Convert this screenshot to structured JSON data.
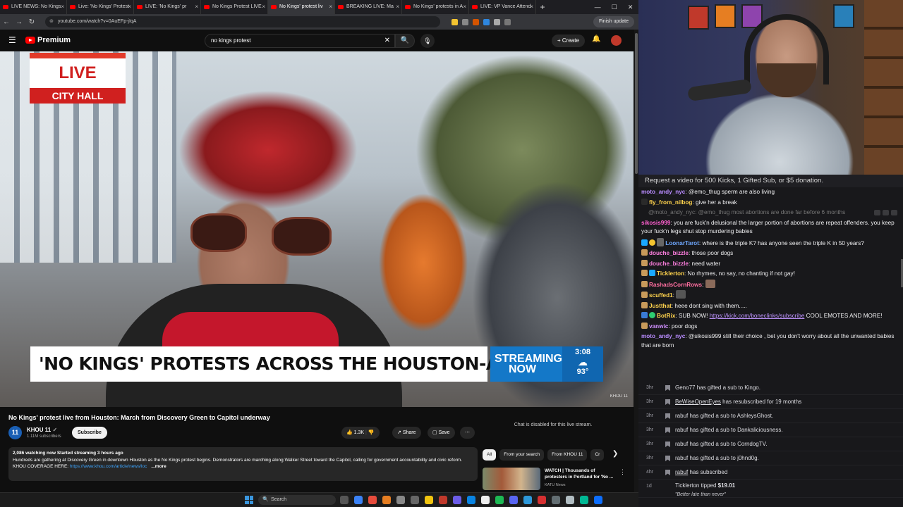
{
  "browser": {
    "tabs": [
      {
        "title": "LIVE NEWS: No Kings",
        "active": false
      },
      {
        "title": "Live: 'No Kings' Protest",
        "active": false
      },
      {
        "title": "LIVE: 'No Kings' pr",
        "active": false
      },
      {
        "title": "No Kings Protest LIVE",
        "active": false
      },
      {
        "title": "No Kings' protest liv",
        "active": true
      },
      {
        "title": "BREAKING LIVE: Ma",
        "active": false
      },
      {
        "title": "No Kings' protests in A",
        "active": false
      },
      {
        "title": "LIVE: VP Vance Attend",
        "active": false
      }
    ],
    "new_tab": "+",
    "window_controls": [
      "—",
      "☐",
      "✕"
    ],
    "url": "youtube.com/watch?v=0AuEFp-jIqA",
    "finish_update": "Finish update"
  },
  "youtube": {
    "logo": "Premium",
    "search_value": "no kings protest",
    "clear": "✕",
    "search_icon": "🔍",
    "mic_icon": "🎙",
    "create": "+ Create",
    "bell": "🔔",
    "video": {
      "live_label": "LIVE",
      "location": "CITY HALL",
      "headline": "'NO KINGS' PROTESTS ACROSS THE HOUSTON-AREA",
      "streaming_line1": "STREAMING",
      "streaming_line2": "NOW",
      "time": "3:08",
      "weather_icon": "☁",
      "temperature": "93°",
      "bug": "KHOU 11"
    },
    "title": "No Kings' protest live from Houston: March from Discovery Green to Capitol underway",
    "channel": {
      "logo_text": "11",
      "name": "KHOU 11",
      "subscribers": "1.11M subscribers",
      "subscribe": "Subscribe"
    },
    "actions": {
      "likes": "1.3K",
      "like_icon": "👍",
      "dislike_icon": "👎",
      "share": "Share",
      "save": "Save",
      "more": "⋯"
    },
    "description": {
      "meta": "2,086 watching now  Started streaming 3 hours ago",
      "text": "Hundreds are gathering at Discovery Green in downtown Houston as the No Kings protest begins. Demonstrators are marching along Walker Street toward the Capitol, calling for government accountability and civic reform.",
      "link_prefix": "KHOU COVERAGE HERE: ",
      "link": "https://www.khou.com/article/news/loc",
      "more": "...more"
    },
    "chat_disabled": "Chat is disabled for this live stream.",
    "chips": [
      "All",
      "From your search",
      "From KHOU 11",
      "Cr"
    ],
    "chips_arrow": "❯",
    "recommendation": {
      "title": "WATCH | Thousands of protesters in Portland for 'No ...",
      "channel": "KATU News",
      "menu": "⋮"
    }
  },
  "taskbar": {
    "search": "Search",
    "search_icon": "🔍"
  },
  "chat": {
    "banner": "Request a video for 500 Kicks, 1 Gifted Sub, or $5 donation.",
    "messages": [
      {
        "user": "moto_andy_nyc",
        "color": "#b98cff",
        "text": "@emo_thug sperm are also living"
      },
      {
        "user": "fly_from_nilbog",
        "color": "#ffd34d",
        "text": "give her a break"
      },
      {
        "user": "",
        "color": "#777",
        "text": "@moto_andy_nyc: @emo_thug most abortions are done far before 6 months",
        "faded": true
      },
      {
        "user": "sikosis999",
        "color": "#ff5fd0",
        "text": "you are fuck'n delusional the larger portion of abortions are repeat offenders. you keep your fuck'n legs shut stop murdering babies",
        "wrap": true
      },
      {
        "user": "LoonarTarot",
        "color": "#6fa8ff",
        "text": "where is the triple K? has anyone seen the triple K in 50 years?"
      },
      {
        "user": "douche_bizzle",
        "color": "#ff7fe0",
        "text": "those poor dogs"
      },
      {
        "user": "douche_bizzle",
        "color": "#ff7fe0",
        "text": "need water"
      },
      {
        "user": "Ticklerton",
        "color": "#ffd34d",
        "text": "No rhymes, no say, no chanting if not gay!"
      },
      {
        "user": "RashadsCornRows",
        "color": "#ff6fa0",
        "text": ""
      },
      {
        "user": "scuffed1",
        "color": "#ffd34d",
        "text": ""
      },
      {
        "user": "Justthat",
        "color": "#ffd34d",
        "text": "heee dont sing with them....."
      },
      {
        "user": "BotRix",
        "color": "#ffd34d",
        "text_before": "SUB NOW! ",
        "link": "https://kick.com/boneclinks/subscribe",
        "text_after": " COOL EMOTES AND MORE!"
      },
      {
        "user": "vanwic",
        "color": "#d090ff",
        "text": "poor dogs"
      },
      {
        "user": "moto_andy_nyc",
        "color": "#b98cff",
        "text": "@sikosis999   still their choice , bet you don't worry about all the unwanted babies that are born",
        "wrap": true
      }
    ],
    "events": [
      {
        "time": "3hr",
        "user": "Geno77",
        "text": " has gifted a sub to ",
        "target": "Kingo."
      },
      {
        "time": "3hr",
        "user": "BeWiseOpenEyes",
        "text": " has resubscribed for 19 months",
        "target": "",
        "underline": true
      },
      {
        "time": "3hr",
        "user": "rabuf",
        "text": " has gifted a sub to ",
        "target": "AshleysGhost."
      },
      {
        "time": "3hr",
        "user": "rabuf",
        "text": " has gifted a sub to ",
        "target": "Dankaliciousness."
      },
      {
        "time": "3hr",
        "user": "rabuf",
        "text": " has gifted a sub to ",
        "target": "CorndogTV."
      },
      {
        "time": "3hr",
        "user": "rabuf",
        "text": " has gifted a sub to ",
        "target": "j0hnd0g."
      },
      {
        "time": "4hr",
        "user": "rabuf",
        "text": " has subscribed",
        "target": "",
        "underline": true
      }
    ],
    "tip": {
      "time": "1d",
      "user": "Ticklerton",
      "text": " tipped ",
      "amount": "$19.01",
      "message": "\"Better late than never\""
    }
  },
  "colors": {
    "youtube_red": "#ff0000",
    "live_red": "#d0201f",
    "streaming_blue": "#1478c8",
    "chat_bg": "#18181b"
  }
}
